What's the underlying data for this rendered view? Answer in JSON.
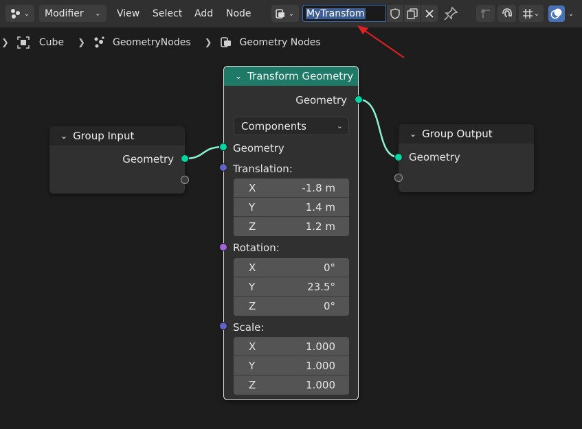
{
  "header": {
    "editor_type_icon": "node-editor-icon",
    "mode_label": "Modifier",
    "menus": [
      "View",
      "Select",
      "Add",
      "Node"
    ],
    "node_group_icon": "node-tree-icon",
    "node_group_name": "MyTransfom",
    "fake_user_icon": "shield-icon",
    "duplicate_icon": "duplicate-icon",
    "close_icon": "close-icon",
    "pin_icon": "pin-icon",
    "parent_icon": "arrow-up-icon",
    "snap_icon": "magnet-icon",
    "snap_mode_icon": "grid-snap-icon",
    "overlay_icon": "overlay-icon"
  },
  "breadcrumb": {
    "object": "Cube",
    "modifier": "GeometryNodes",
    "node_tree": "Geometry Nodes"
  },
  "nodes": {
    "group_input": {
      "title": "Group Input",
      "output_label": "Geometry"
    },
    "transform": {
      "title": "Transform Geometry",
      "output_label": "Geometry",
      "mode": "Components",
      "input_label": "Geometry",
      "translation_label": "Translation:",
      "translation": [
        {
          "axis": "X",
          "value": "-1.8 m"
        },
        {
          "axis": "Y",
          "value": "1.4 m"
        },
        {
          "axis": "Z",
          "value": "1.2 m"
        }
      ],
      "rotation_label": "Rotation:",
      "rotation": [
        {
          "axis": "X",
          "value": "0°"
        },
        {
          "axis": "Y",
          "value": "23.5°"
        },
        {
          "axis": "Z",
          "value": "0°"
        }
      ],
      "scale_label": "Scale:",
      "scale": [
        {
          "axis": "X",
          "value": "1.000"
        },
        {
          "axis": "Y",
          "value": "1.000"
        },
        {
          "axis": "Z",
          "value": "1.000"
        }
      ]
    },
    "group_output": {
      "title": "Group Output",
      "input_label": "Geometry"
    }
  },
  "colors": {
    "transform_header": "#1e7a66",
    "io_header": "#262626",
    "geometry_socket": "#00d6a3",
    "vector_socket": "#6363c7",
    "rotation_socket": "#a363d6",
    "link": "#8ff2d2",
    "annotation_arrow": "#e02020"
  }
}
